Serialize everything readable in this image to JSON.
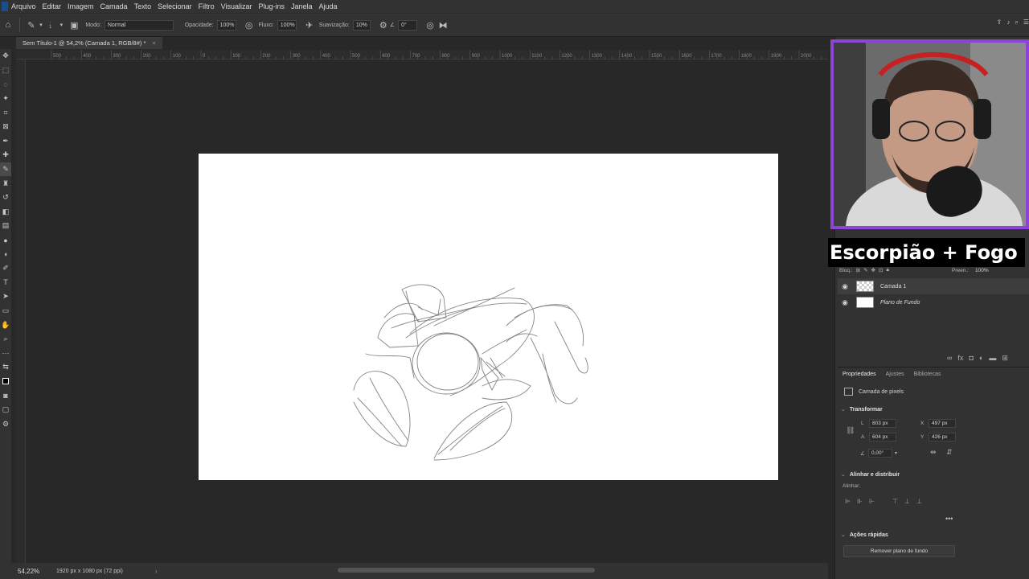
{
  "menu": [
    "Arquivo",
    "Editar",
    "Imagem",
    "Camada",
    "Texto",
    "Selecionar",
    "Filtro",
    "Visualizar",
    "Plug-ins",
    "Janela",
    "Ajuda"
  ],
  "options": {
    "brush_size": "1",
    "mode_label": "Modo:",
    "mode_value": "Normal",
    "opacity_label": "Opacidade:",
    "opacity_value": "100%",
    "flow_label": "Fluxo:",
    "flow_value": "100%",
    "smoothing_label": "Suavização:",
    "smoothing_value": "10%",
    "angle_value": "0°"
  },
  "document": {
    "tab_title": "Sem Título-1 @ 54,2% (Camada 1, RGB/8#) *",
    "close_glyph": "×"
  },
  "ruler": {
    "labels": [
      "500",
      "400",
      "300",
      "200",
      "100",
      "0",
      "100",
      "200",
      "300",
      "400",
      "500",
      "600",
      "700",
      "800",
      "900",
      "1000",
      "1100",
      "1200",
      "1300",
      "1400",
      "1500",
      "1600",
      "1700",
      "1800",
      "1900",
      "2000",
      "2100",
      "2200"
    ]
  },
  "overlay": {
    "title": "Escorpião + Fogo"
  },
  "layers": {
    "lock_label": "Bloq.:",
    "fill_label": "Preen.:",
    "fill_value": "100%",
    "items": [
      {
        "name": "Camada 1",
        "selected": true
      },
      {
        "name": "Plano de Fundo",
        "selected": false
      }
    ]
  },
  "properties": {
    "tabs": [
      "Propriedades",
      "Ajustes",
      "Bibliotecas"
    ],
    "pixel_layer": "Camada de pixels",
    "transform_title": "Transformar",
    "w_label": "L",
    "w_value": "803 px",
    "h_label": "A",
    "h_value": "604 px",
    "x_label": "X",
    "x_value": "497 px",
    "y_label": "Y",
    "y_value": "426 px",
    "angle_value": "0,00°",
    "align_title": "Alinhar e distribuir",
    "align_label": "Alinhar:",
    "more_glyph": "•••",
    "quick_actions_title": "Ações rápidas",
    "remove_bg_button": "Remover plano de fundo"
  },
  "status": {
    "zoom": "54,22%",
    "doc_info": "1920 px x 1080 px (72 ppi)",
    "arrow": "›"
  },
  "colors": {
    "accent_frame": "#8b44d6",
    "panel_bg": "#323232",
    "workspace_bg": "#282828"
  }
}
